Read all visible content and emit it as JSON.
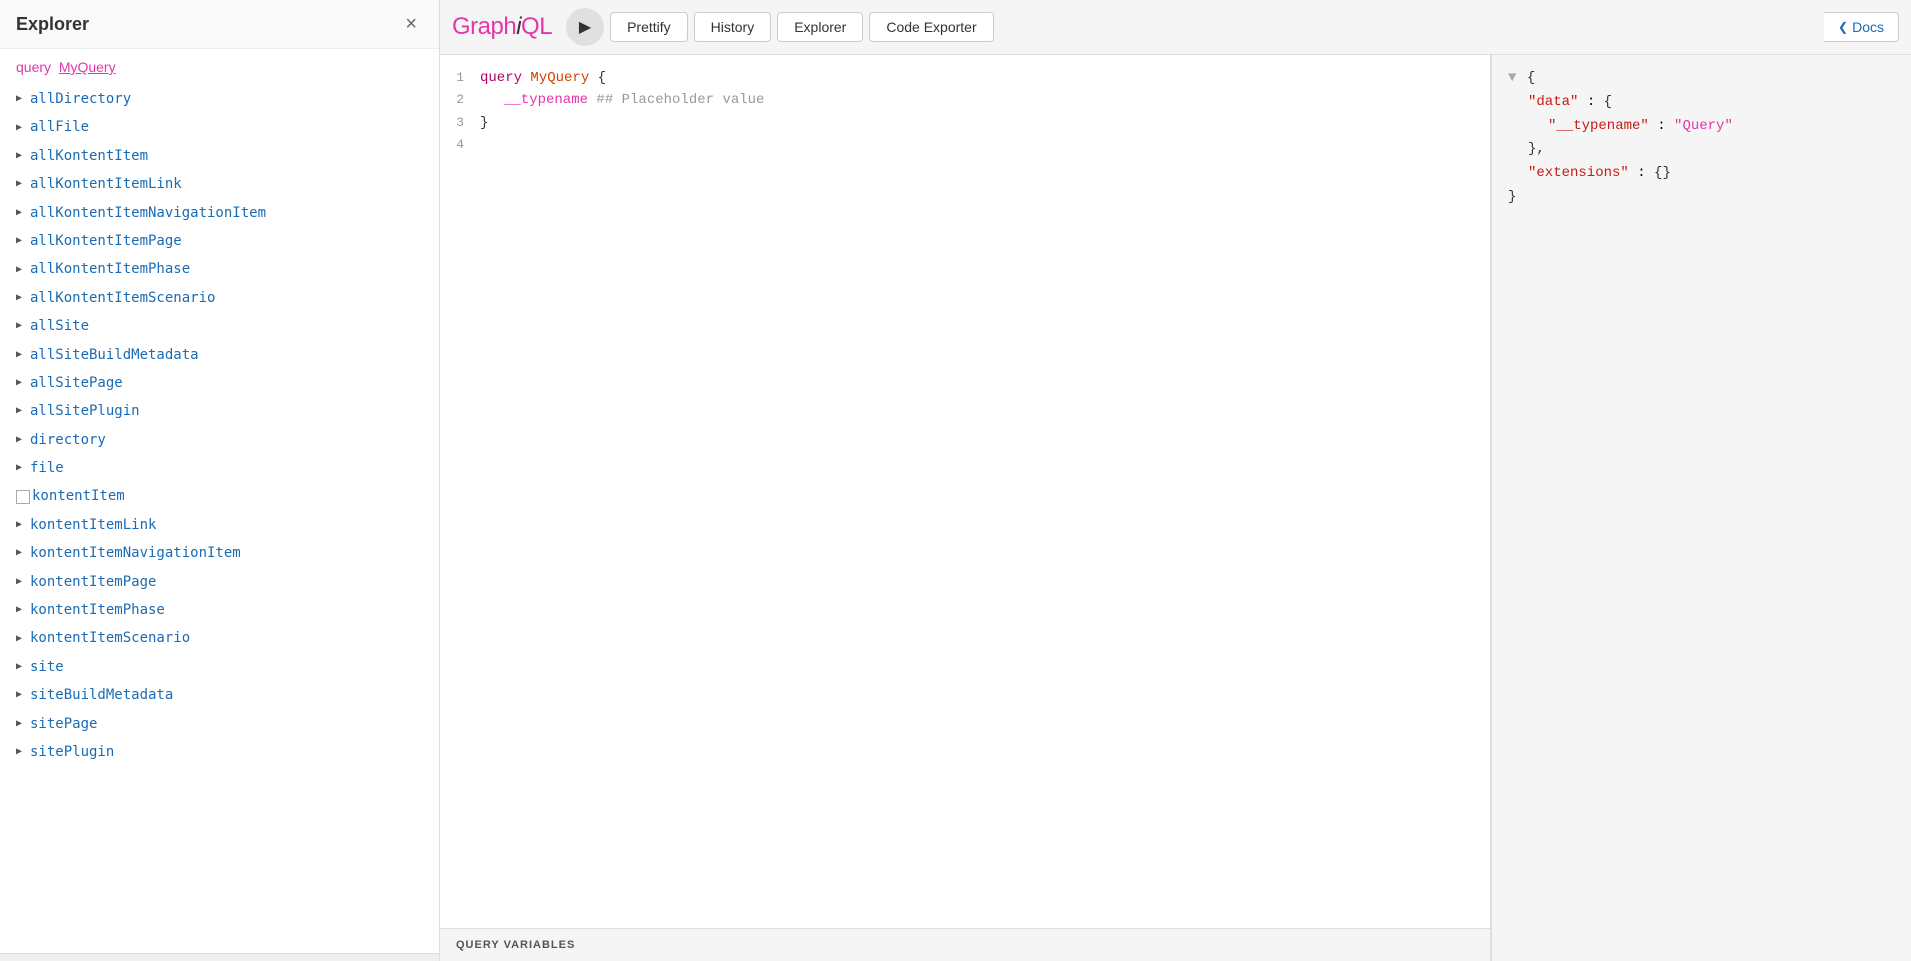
{
  "explorer": {
    "title": "Explorer",
    "close_label": "×",
    "query_prefix": "query",
    "query_name": "MyQuery",
    "items": [
      {
        "label": "allDirectory",
        "type": "arrow"
      },
      {
        "label": "allFile",
        "type": "arrow"
      },
      {
        "label": "allKontentItem",
        "type": "arrow"
      },
      {
        "label": "allKontentItemLink",
        "type": "arrow"
      },
      {
        "label": "allKontentItemNavigationItem",
        "type": "arrow"
      },
      {
        "label": "allKontentItemPage",
        "type": "arrow"
      },
      {
        "label": "allKontentItemPhase",
        "type": "arrow"
      },
      {
        "label": "allKontentItemScenario",
        "type": "arrow"
      },
      {
        "label": "allSite",
        "type": "arrow"
      },
      {
        "label": "allSiteBuildMetadata",
        "type": "arrow"
      },
      {
        "label": "allSitePage",
        "type": "arrow"
      },
      {
        "label": "allSitePlugin",
        "type": "arrow"
      },
      {
        "label": "directory",
        "type": "arrow"
      },
      {
        "label": "file",
        "type": "arrow"
      },
      {
        "label": "kontentItem",
        "type": "checkbox"
      },
      {
        "label": "kontentItemLink",
        "type": "arrow"
      },
      {
        "label": "kontentItemNavigationItem",
        "type": "arrow"
      },
      {
        "label": "kontentItemPage",
        "type": "arrow"
      },
      {
        "label": "kontentItemPhase",
        "type": "arrow"
      },
      {
        "label": "kontentItemScenario",
        "type": "arrow"
      },
      {
        "label": "site",
        "type": "arrow"
      },
      {
        "label": "siteBuildMetadata",
        "type": "arrow"
      },
      {
        "label": "sitePage",
        "type": "arrow"
      },
      {
        "label": "sitePlugin",
        "type": "arrow"
      }
    ]
  },
  "toolbar": {
    "logo": "GraphiQL",
    "logo_i": "i",
    "run_label": "▶",
    "prettify_label": "Prettify",
    "history_label": "History",
    "explorer_label": "Explorer",
    "code_exporter_label": "Code Exporter",
    "docs_label": "Docs"
  },
  "editor": {
    "lines": [
      {
        "num": "1",
        "content_type": "query_header"
      },
      {
        "num": "2",
        "content_type": "typename_field"
      },
      {
        "num": "3",
        "content_type": "close_brace"
      },
      {
        "num": "4",
        "content_type": "empty"
      }
    ],
    "query_keyword": "query",
    "query_name": "MyQuery",
    "field_name": "__typename",
    "comment": "## Placeholder value",
    "query_variables_label": "QUERY VARIABLES"
  },
  "result": {
    "lines": [
      "{",
      "  \"data\": {",
      "    \"__typename\": \"Query\"",
      "  },",
      "  \"extensions\": {}",
      "}"
    ],
    "data_key": "\"data\"",
    "data_value": "{",
    "typename_key": "\"__typename\"",
    "typename_value": "\"Query\"",
    "extensions_key": "\"extensions\"",
    "extensions_value": "{}"
  }
}
